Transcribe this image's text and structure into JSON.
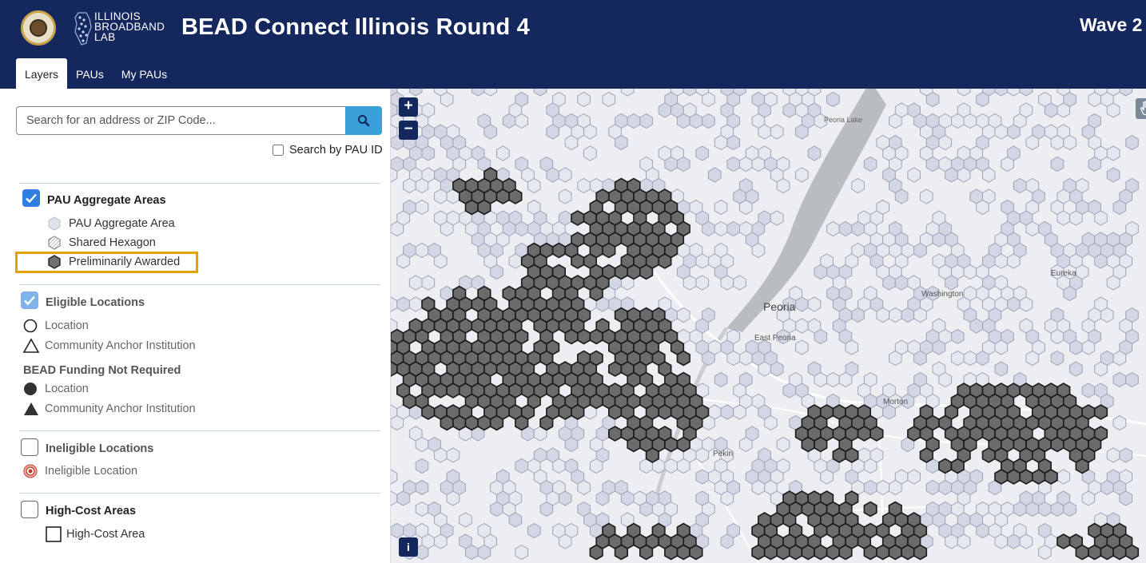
{
  "header": {
    "logo_text": [
      "ILLINOIS",
      "BROADBAND",
      "LAB"
    ],
    "title": "BEAD Connect Illinois Round 4",
    "wave_label": "Wave 2",
    "tabs": [
      {
        "label": "Layers",
        "active": true
      },
      {
        "label": "PAUs",
        "active": false
      },
      {
        "label": "My PAUs",
        "active": false
      }
    ],
    "background_color": "#14285e"
  },
  "search": {
    "placeholder": "Search for an address or ZIP Code...",
    "value": "",
    "pau_id_label": "Search by PAU ID",
    "pau_id_checked": false,
    "button_color": "#3aa0d8"
  },
  "layers": {
    "pau_aggregate": {
      "title": "PAU Aggregate Areas",
      "checked": true,
      "items": [
        {
          "label": "PAU Aggregate Area",
          "icon": "light-hexagon-icon"
        },
        {
          "label": "Shared Hexagon",
          "icon": "hatched-hexagon-icon"
        },
        {
          "label": "Preliminarily Awarded",
          "icon": "dark-hexagon-icon",
          "highlighted": true
        }
      ]
    },
    "eligible": {
      "title": "Eligible Locations",
      "checked": true,
      "items": [
        {
          "label": "Location",
          "icon": "circle-outline-icon"
        },
        {
          "label": "Community Anchor Institution",
          "icon": "triangle-outline-icon"
        }
      ],
      "sub_title": "BEAD Funding Not Required",
      "sub_items": [
        {
          "label": "Location",
          "icon": "filled-circle-icon"
        },
        {
          "label": "Community Anchor Institution",
          "icon": "filled-triangle-icon"
        }
      ]
    },
    "ineligible": {
      "title": "Ineligible Locations",
      "checked": false,
      "items": [
        {
          "label": "Ineligible Location",
          "icon": "ineligible-target-icon"
        }
      ]
    },
    "high_cost": {
      "title": "High-Cost Areas",
      "checked": false,
      "items": [
        {
          "label": "High-Cost Area",
          "icon": "square-outline-icon"
        }
      ]
    },
    "highlight_color": "#e5a100"
  },
  "map": {
    "zoom_in": "+",
    "zoom_out": "−",
    "info": "i",
    "labels": [
      {
        "text": "Peoria Lake",
        "kind": "water"
      },
      {
        "text": "Peoria",
        "kind": "big"
      },
      {
        "text": "East Peoria",
        "kind": "small"
      },
      {
        "text": "Washington",
        "kind": "small"
      },
      {
        "text": "Eureka",
        "kind": "small"
      },
      {
        "text": "Morton",
        "kind": "small"
      },
      {
        "text": "Pekin",
        "kind": "small"
      }
    ],
    "awarded_color": "#6b6b6b",
    "aggregate_color": "#d3d6e3",
    "base_color": "#eceef1"
  }
}
